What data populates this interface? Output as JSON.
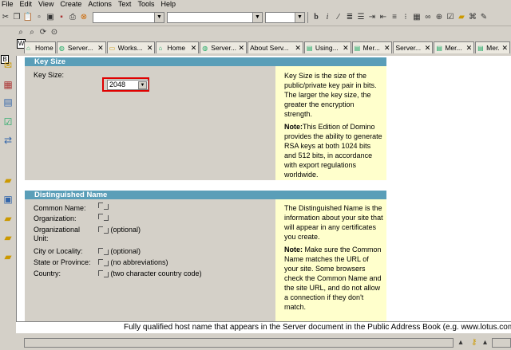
{
  "menu": [
    "File",
    "Edit",
    "View",
    "Create",
    "Actions",
    "Text",
    "Tools",
    "Help"
  ],
  "tabs": [
    {
      "label": "Home",
      "icon": "home-icon"
    },
    {
      "label": "Server...",
      "icon": "globe-icon"
    },
    {
      "label": "Works...",
      "icon": "folder-icon"
    },
    {
      "label": "Home",
      "icon": "home-icon"
    },
    {
      "label": "Server...",
      "icon": "globe-icon"
    },
    {
      "label": "About Serv...",
      "icon": ""
    },
    {
      "label": "Using...",
      "icon": "document-icon"
    },
    {
      "label": "Mer...",
      "icon": "document-icon"
    },
    {
      "label": "Server...",
      "icon": ""
    },
    {
      "label": "Mer...",
      "icon": "document-icon"
    },
    {
      "label": "Mer...",
      "icon": "document-icon"
    }
  ],
  "keysize": {
    "header": "Key Size",
    "label": "Key Size:",
    "value": "2048",
    "note1": "Key Size is the size of the public/private key pair in bits.   The larger the key size, the greater the encryption strength.",
    "note2_bold": "Note:",
    "note2": "This Edition of Domino provides the ability to generate RSA keys at both 1024 bits and 512 bits, in accordance with export regulations worldwide."
  },
  "dn": {
    "header": "Distinguished Name",
    "fields": [
      {
        "label": "Common Name:",
        "hint": ""
      },
      {
        "label": "Organization:",
        "hint": ""
      },
      {
        "label": "Organizational Unit:",
        "hint": "(optional)"
      },
      {
        "label": "City or Locality:",
        "hint": "(optional)"
      },
      {
        "label": "State or Province:",
        "hint": "(no abbreviations)"
      },
      {
        "label": "Country:",
        "hint": "(two character country code)"
      }
    ],
    "note1": "The Distinguished Name is the information about your site that will appear in any certificates you create.",
    "note2_bold": "Note:",
    "note2": "  Make sure the Common Name matches the URL of your site. Some browsers check the Common Name and the site URL, and do not allow a connection if they don't match."
  },
  "hint_line": "Fully qualified host name that appears in the Server document in the Public Address Book (e.g. www.lotus.com)",
  "colors": {
    "header": "#5a9eb8",
    "note_bg": "#ffffcc",
    "highlight": "#e00000"
  }
}
